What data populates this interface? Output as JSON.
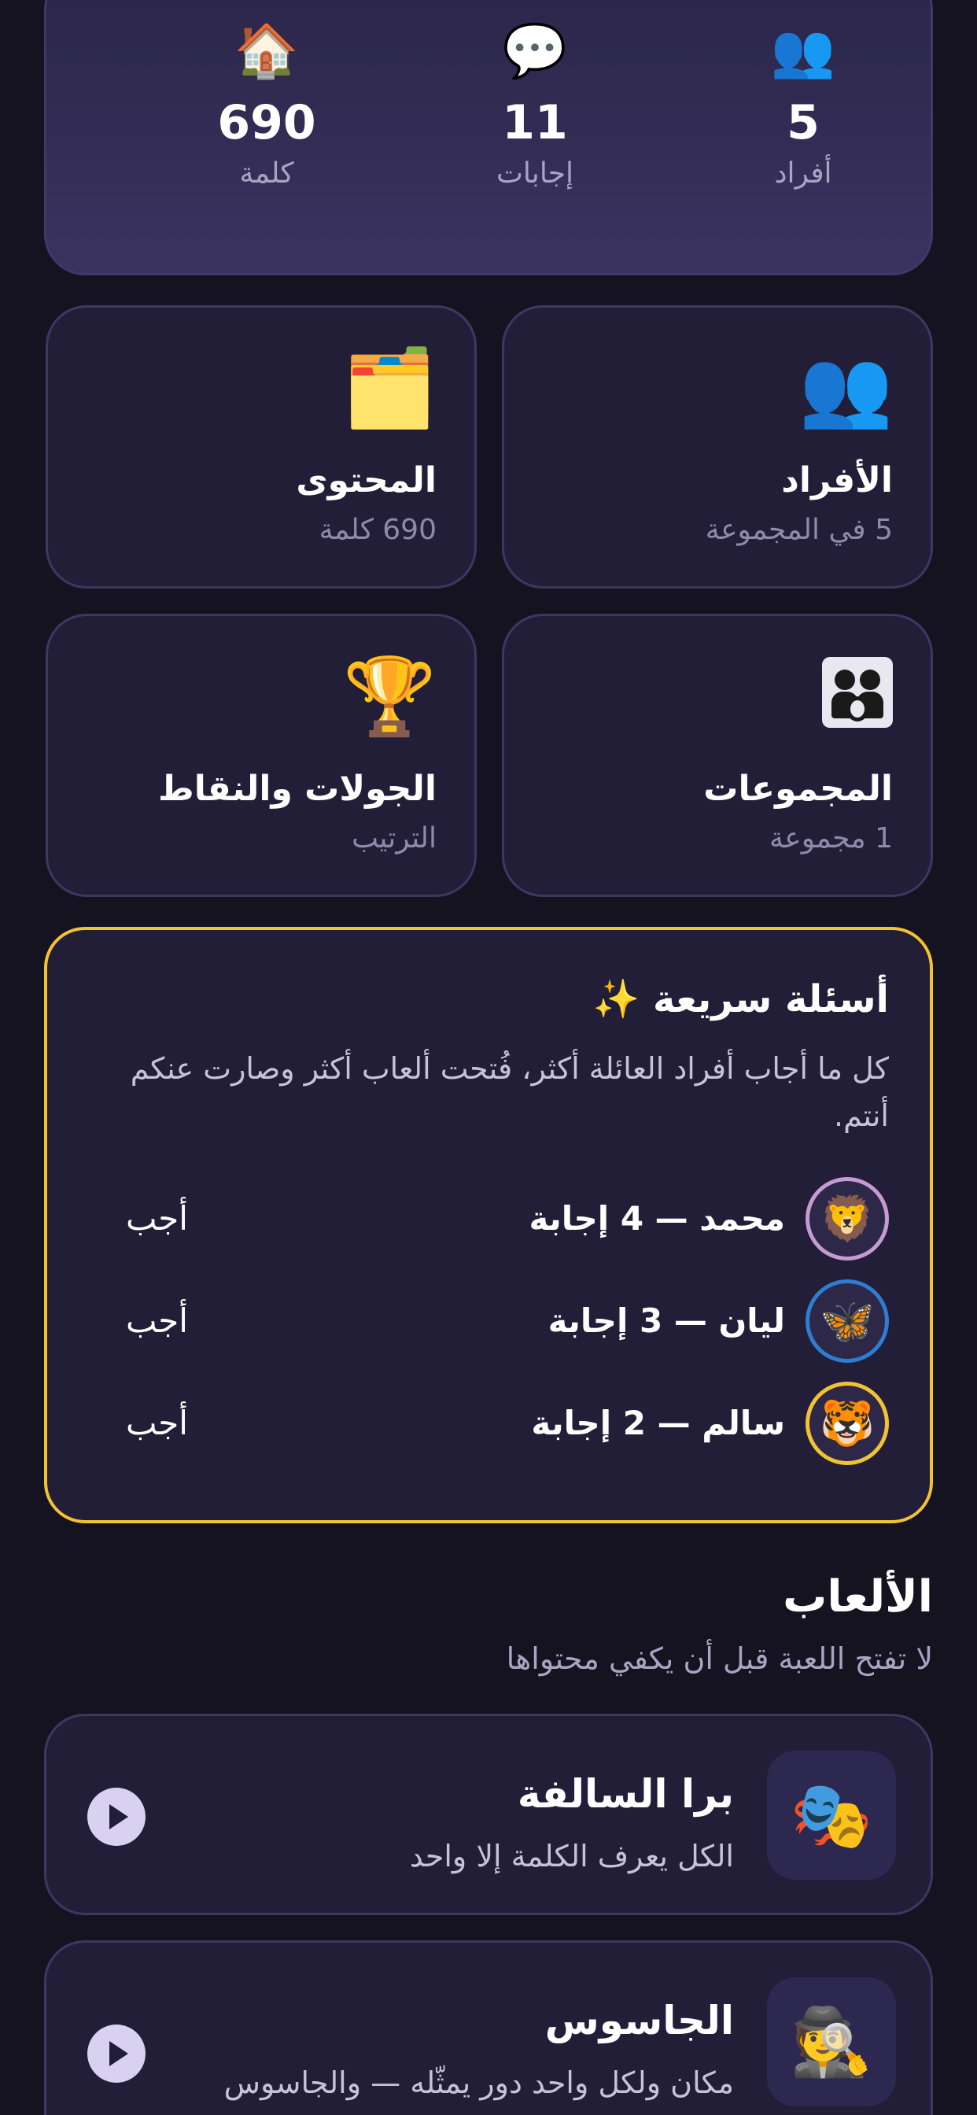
{
  "stats": {
    "members": {
      "icon": "👥",
      "value": "5",
      "label": "أفراد"
    },
    "answers": {
      "icon": "💬",
      "value": "11",
      "label": "إجابات"
    },
    "words": {
      "icon": "🏠",
      "value": "690",
      "label": "كلمة"
    }
  },
  "tiles": {
    "members": {
      "icon": "👥",
      "title": "الأفراد",
      "subtitle": "5 في المجموعة"
    },
    "content": {
      "icon": "🗂️",
      "title": "المحتوى",
      "subtitle": "690 كلمة"
    },
    "groups": {
      "title": "المجموعات",
      "subtitle": "1 مجموعة"
    },
    "rounds": {
      "icon": "🏆",
      "title": "الجولات والنقاط",
      "subtitle": "الترتيب"
    }
  },
  "quick": {
    "title": "أسئلة سريعة ✨",
    "description": "كل ما أجاب أفراد العائلة أكثر، فُتحت ألعاب أكثر وصارت عنكم أنتم.",
    "rows": [
      {
        "avatar": "🦁",
        "text": "محمد — 4 إجابة",
        "action": "أجب"
      },
      {
        "avatar": "🦋",
        "text": "ليان — 3 إجابة",
        "action": "أجب"
      },
      {
        "avatar": "🐯",
        "text": "سالم — 2 إجابة",
        "action": "أجب"
      }
    ]
  },
  "games": {
    "title": "الألعاب",
    "subtitle": "لا تفتح اللعبة قبل أن يكفي محتواها",
    "items": [
      {
        "icon": "🎭",
        "title": "برا السالفة",
        "desc": "الكل يعرف الكلمة إلا واحد"
      },
      {
        "icon": "🕵️",
        "title": "الجاسوس",
        "desc": "مكان ولكل واحد دور يمثّله — والجاسوس يحاول يعرف المكان"
      }
    ]
  }
}
